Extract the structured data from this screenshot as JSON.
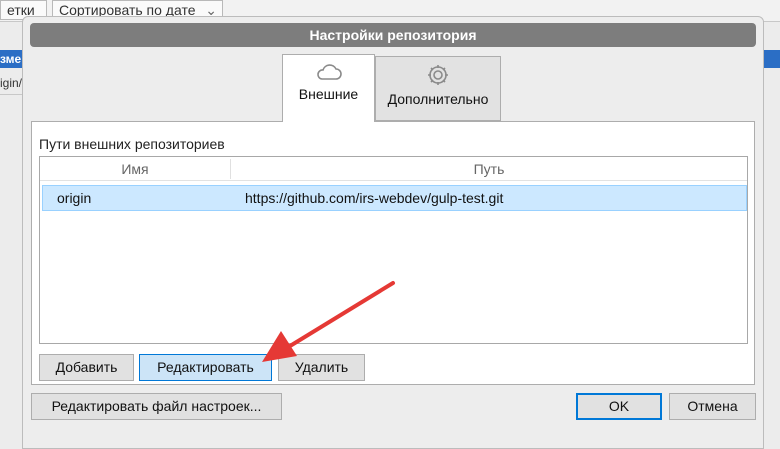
{
  "background": {
    "tab_left": "етки",
    "tab_sort": "Сортировать по дате",
    "left_fragment": "зме",
    "origin_fragment": "igin/"
  },
  "dialog": {
    "title": "Настройки репозитория",
    "tabs": [
      {
        "label": "Внешние",
        "icon": "cloud-icon",
        "active": true
      },
      {
        "label": "Дополнительно",
        "icon": "gear-icon",
        "active": false
      }
    ],
    "caption": "Пути внешних репозиториев",
    "columns": {
      "name": "Имя",
      "path": "Путь"
    },
    "rows": [
      {
        "name": "origin",
        "path": "https://github.com/irs-webdev/gulp-test.git",
        "selected": true
      }
    ],
    "buttons": {
      "add": "Добавить",
      "edit": "Редактировать",
      "delete": "Удалить",
      "edit_config": "Редактировать файл настроек...",
      "ok": "OK",
      "cancel": "Отмена"
    }
  },
  "colors": {
    "titlebar": "#7d7d7d",
    "selection": "#cce8ff",
    "accent": "#0078d7",
    "annotation_arrow": "#e53935"
  }
}
